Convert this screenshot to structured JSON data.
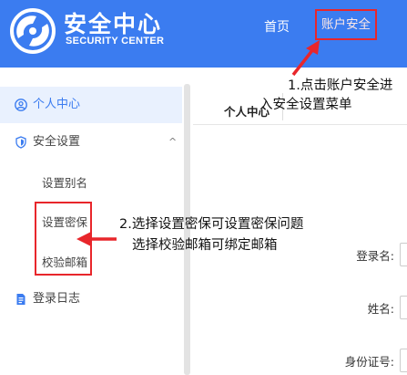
{
  "header": {
    "logo_title": "安全中心",
    "logo_subtitle": "SECURITY CENTER",
    "nav": {
      "home": "首页",
      "account_security": "账户安全"
    }
  },
  "sidebar": {
    "items": [
      {
        "label": "个人中心",
        "icon": "user-icon",
        "active": true
      },
      {
        "label": "安全设置",
        "icon": "shield-icon",
        "expanded": true,
        "children": [
          "设置别名",
          "设置密保",
          "校验邮箱"
        ]
      },
      {
        "label": "登录日志",
        "icon": "document-icon"
      }
    ],
    "chevron": "^"
  },
  "main": {
    "tab": "个人中心",
    "fields": {
      "login_name": "登录名:",
      "name": "姓名:",
      "id_number": "身份证号:"
    }
  },
  "annotations": {
    "step1_line1": "1.点击账户安全进",
    "step1_line2": "入安全设置菜单",
    "step2_line1": "2.选择设置密保可设置密保问题",
    "step2_line2": "选择校验邮箱可绑定邮箱"
  },
  "colors": {
    "brand": "#3b7cf0",
    "highlight": "#e8262b",
    "active_bg": "#e9f1fe"
  }
}
